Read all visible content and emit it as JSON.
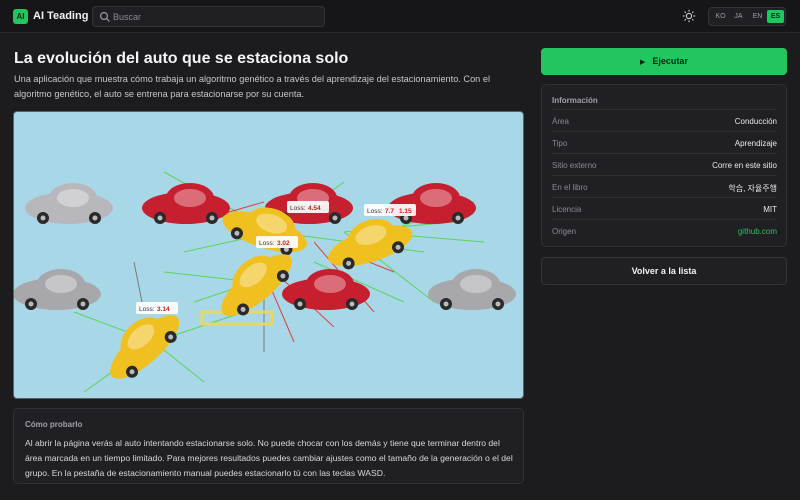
{
  "header": {
    "logo_text": "AI",
    "brand": "AI Teading",
    "search_placeholder": "Buscar",
    "languages": [
      "KO",
      "JA",
      "EN",
      "ES"
    ],
    "active_language": "ES"
  },
  "main": {
    "title": "La evolución del auto que se estaciona solo",
    "description": "Una aplicación que muestra cómo trabaja un algoritmo genético a través del aprendizaje del estacionamiento. Con el algoritmo genético, el auto se entrena para estacionarse por su cuenta.",
    "simulation": {
      "loss_prefix": "Loss:",
      "loss_labels": [
        "4.54",
        "7.7",
        "1.15",
        "3.02",
        "3.14"
      ]
    },
    "howto": {
      "title": "Cómo probarlo",
      "text": "Al abrir la página verás al auto intentando estacionarse solo. No puede chocar con los demás y tiene que terminar dentro del área marcada en un tiempo limitado. Para mejores resultados puedes cambiar ajustes como el tamaño de la generación o el del grupo. En la pestaña de estacionamiento manual puedes estacionarlo tú con las teclas WASD."
    }
  },
  "sidebar": {
    "run_label": "Ejecutar",
    "info_title": "Información",
    "info_rows": [
      {
        "key": "Área",
        "value": "Conducción"
      },
      {
        "key": "Tipo",
        "value": "Aprendizaje"
      },
      {
        "key": "Sitio externo",
        "value": "Corre en este sitio"
      },
      {
        "key": "En el libro",
        "value": "학습, 자율주행"
      },
      {
        "key": "Licencia",
        "value": "MIT"
      },
      {
        "key": "Origen",
        "value": "github.com"
      }
    ],
    "back_label": "Volver a la lista"
  },
  "colors": {
    "accent": "#22c55e",
    "background": "#1c1c1f",
    "sim_background": "#a8d8e8"
  }
}
